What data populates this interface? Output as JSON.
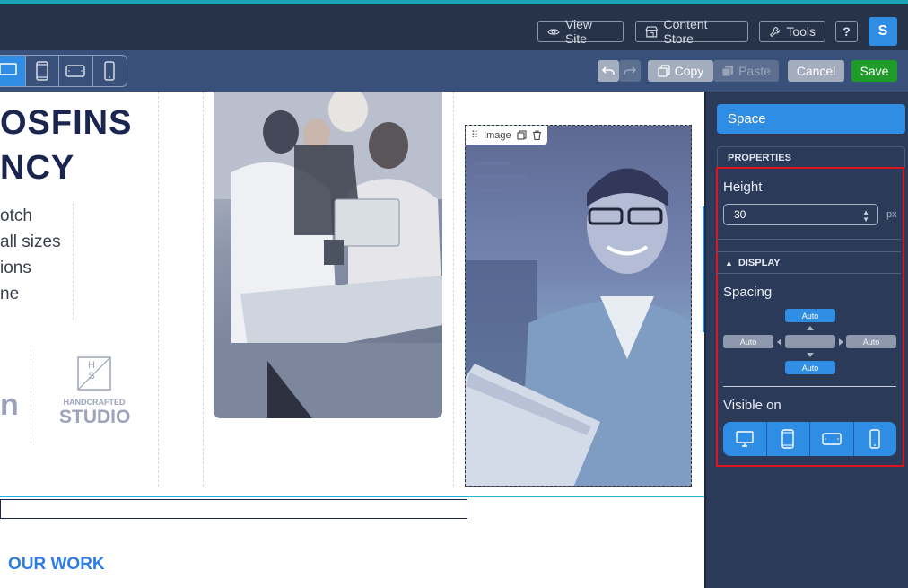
{
  "topbar": {
    "view_site": "View Site",
    "content_store": "Content Store",
    "tools": "Tools",
    "help": "?",
    "avatar_initial": "S"
  },
  "toolbar": {
    "copy": "Copy",
    "paste": "Paste",
    "cancel": "Cancel",
    "save": "Save"
  },
  "canvas": {
    "hero_line1": "OSFINS",
    "hero_line2": "NCY",
    "text_lines": [
      "otch",
      "all sizes",
      "ions",
      "ne"
    ],
    "logo_partial": "n",
    "logo_letters": "H S",
    "logo_small": "HANDCRAFTED",
    "logo_big": "STUDIO",
    "image_tag": "Image",
    "section_heading": "OUR WORK"
  },
  "panel": {
    "tab": "Space",
    "properties_header": "PROPERTIES",
    "height_label": "Height",
    "height_value": "30",
    "height_unit": "px",
    "display_header": "DISPLAY",
    "spacing_label": "Spacing",
    "spacing": {
      "top": "Auto",
      "left": "Auto",
      "right": "Auto",
      "bottom": "Auto"
    },
    "visible_on_label": "Visible on"
  },
  "colors": {
    "accent": "#2f8de4",
    "save": "#1f9b2a",
    "highlight": "#e0141c",
    "topbar": "#263348",
    "panel": "#2b3a58"
  }
}
